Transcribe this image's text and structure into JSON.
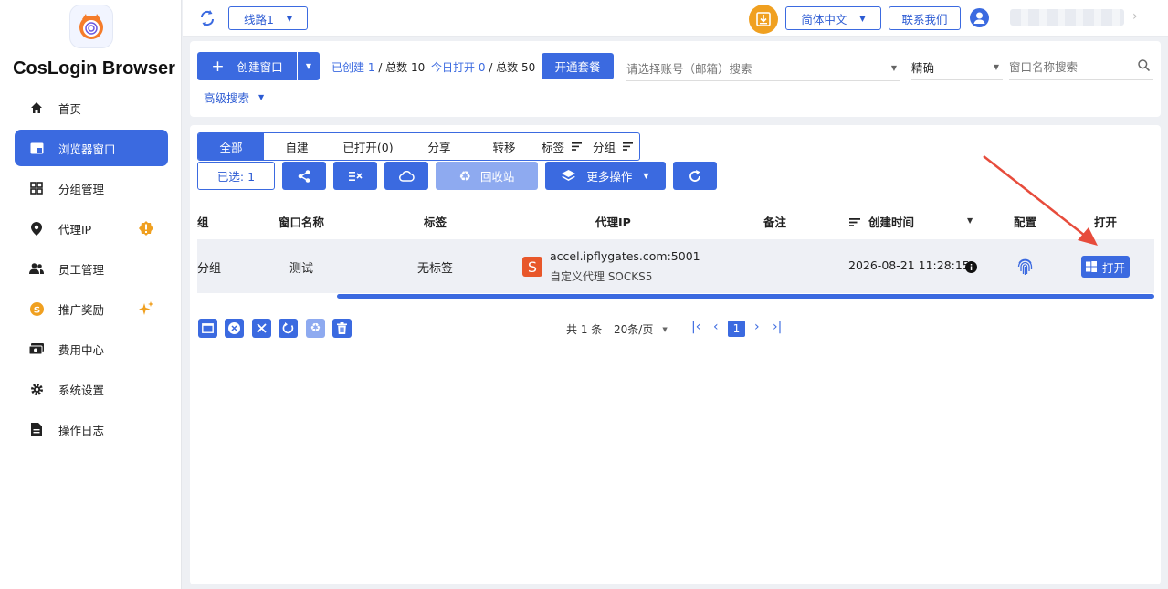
{
  "app": {
    "brand": "CosLogin Browser"
  },
  "nav": [
    {
      "label": "首页",
      "icon": "home-icon"
    },
    {
      "label": "浏览器窗口",
      "icon": "window-icon",
      "active": true
    },
    {
      "label": "分组管理",
      "icon": "grid-icon"
    },
    {
      "label": "代理IP",
      "icon": "location-pin-icon",
      "badge": "!"
    },
    {
      "label": "员工管理",
      "icon": "users-icon"
    },
    {
      "label": "推广奖励",
      "icon": "coin-icon"
    },
    {
      "label": "费用中心",
      "icon": "payment-icon"
    },
    {
      "label": "系统设置",
      "icon": "gear-icon"
    },
    {
      "label": "操作日志",
      "icon": "document-icon"
    }
  ],
  "topbar": {
    "route": "线路1",
    "language": "简体中文",
    "contact": "联系我们"
  },
  "toolbar": {
    "create": "创建窗口",
    "created_prefix": "已创建",
    "created_count": "1",
    "created_total_label": "/ 总数 10",
    "opened_prefix": "今日打开",
    "opened_count": "0",
    "opened_total_label": "/ 总数 50",
    "subscribe": "开通套餐",
    "account_placeholder": "请选择账号（邮箱）搜索",
    "match_mode": "精确",
    "name_placeholder": "窗口名称搜索",
    "advanced": "高级搜索"
  },
  "tabs": [
    "全部",
    "自建",
    "已打开(0)",
    "分享",
    "转移",
    "标签",
    "分组"
  ],
  "actions": {
    "selected": "已选: 1",
    "recycle": "回收站",
    "more": "更多操作"
  },
  "table": {
    "headers": [
      "组",
      "窗口名称",
      "标签",
      "代理IP",
      "备注",
      "创建时间",
      "配置",
      "打开"
    ],
    "row": {
      "group": "分组",
      "name": "测试",
      "tag": "无标签",
      "proxy_host": "accel.ipflygates.com:5001",
      "proxy_type": "自定义代理 SOCKS5",
      "proxy_badge": "S",
      "note": "",
      "created": "2026-08-21 11:28:15",
      "open": "打开"
    }
  },
  "pagination": {
    "total": "共 1 条",
    "page_size": "20条/页",
    "current": "1"
  },
  "colors": {
    "primary": "#3b6ae0",
    "warning": "#f0a020",
    "proxy_badge": "#e8572a",
    "arrow": "#e74c3c"
  }
}
